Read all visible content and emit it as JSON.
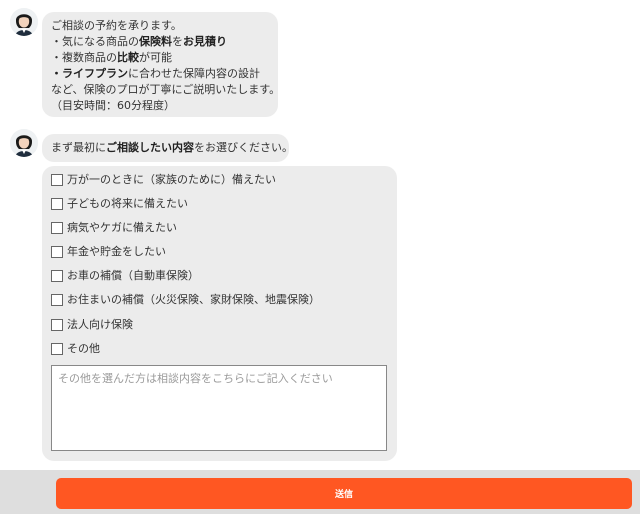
{
  "colors": {
    "bubble_bg": "#ececec",
    "submit_bg": "#ff5722",
    "footer_bg": "#dedede",
    "text": "#333333"
  },
  "messages": [
    {
      "avatar_icon": "operator-avatar-icon",
      "lines": [
        {
          "parts": [
            "ご相談の予約を承ります。"
          ]
        },
        {
          "parts": [
            "・気になる商品の",
            "保険料",
            "を",
            "お見積り"
          ]
        },
        {
          "parts": [
            "・複数商品の",
            "比較",
            "が可能"
          ]
        },
        {
          "parts": [
            "・ライフプラン",
            "に合わせた保障内容の設計"
          ]
        },
        {
          "parts": [
            "など、保険のプロが丁寧にご説明いたします。"
          ]
        },
        {
          "parts": [
            "（目安時間：60分程度）"
          ]
        }
      ]
    },
    {
      "avatar_icon": "operator-avatar-icon",
      "parts": [
        "まず最初に",
        "ご相談したい内容",
        "をお選びください。"
      ]
    }
  ],
  "form": {
    "options": [
      {
        "label": "万が一のときに（家族のために）備えたい",
        "checked": false
      },
      {
        "label": "子どもの将来に備えたい",
        "checked": false
      },
      {
        "label": "病気やケガに備えたい",
        "checked": false
      },
      {
        "label": "年金や貯金をしたい",
        "checked": false
      },
      {
        "label": "お車の補償（自動車保険）",
        "checked": false
      },
      {
        "label": "お住まいの補償（火災保険、家財保険、地震保険）",
        "checked": false
      },
      {
        "label": "法人向け保険",
        "checked": false
      },
      {
        "label": "その他",
        "checked": false
      }
    ],
    "detail": {
      "value": "",
      "placeholder": "その他を選んだ方は相談内容をこちらにご記入ください"
    }
  },
  "footer": {
    "submit_label": "送信"
  }
}
